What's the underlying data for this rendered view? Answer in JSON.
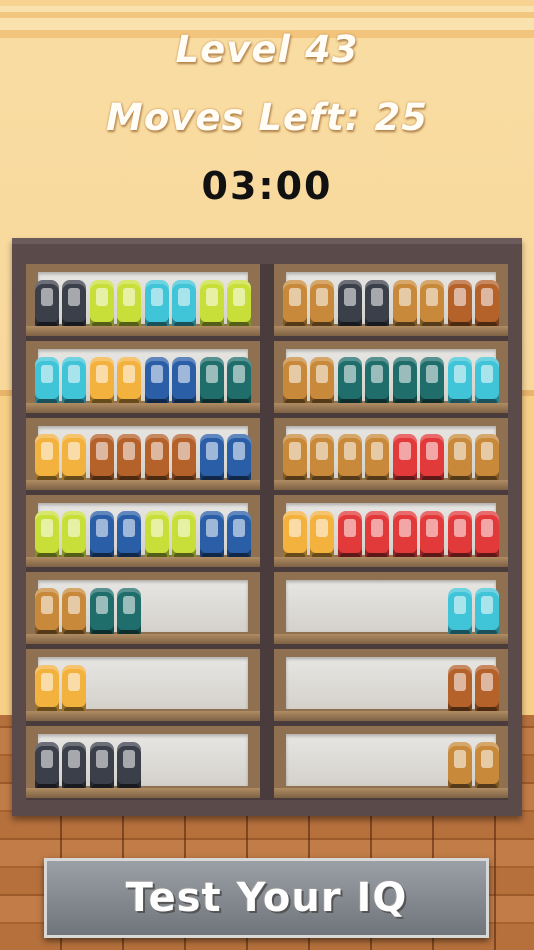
{
  "hud": {
    "level": "Level 43",
    "moves": "Moves Left: 25",
    "timer": "03:00"
  },
  "colors": {
    "sky": "#40c4d8",
    "navy": "#2a5fa8",
    "teal": "#1f6e6b",
    "lime": "#c8df3a",
    "purple": "#3b3f4a",
    "brown": "#b4612a",
    "tan": "#c88a3a",
    "red": "#e23a3a",
    "graffiti": "#f3b13e",
    "blackwhite": "#444444"
  },
  "shelves": [
    {
      "label": "shelf-1-left",
      "pairs": [
        "purple",
        "lime",
        "sky",
        "lime"
      ]
    },
    {
      "label": "shelf-1-right",
      "pairs": [
        "tan",
        "purple",
        "tan",
        "brown"
      ]
    },
    {
      "label": "shelf-2-left",
      "pairs": [
        "sky",
        "graffiti",
        "navy",
        "teal"
      ]
    },
    {
      "label": "shelf-2-right",
      "pairs": [
        "tan",
        "teal",
        "teal",
        "sky"
      ]
    },
    {
      "label": "shelf-3-left",
      "pairs": [
        "graffiti",
        "brown",
        "brown",
        "navy"
      ]
    },
    {
      "label": "shelf-3-right",
      "pairs": [
        "tan",
        "tan",
        "red",
        "tan"
      ]
    },
    {
      "label": "shelf-4-left",
      "pairs": [
        "lime",
        "navy",
        "lime",
        "navy"
      ]
    },
    {
      "label": "shelf-4-right",
      "pairs": [
        "graffiti",
        "red",
        "red",
        "red"
      ]
    },
    {
      "label": "shelf-5-left",
      "pairs": [
        "tan",
        "teal",
        "",
        ""
      ]
    },
    {
      "label": "shelf-5-right",
      "pairs": [
        "",
        "",
        "",
        "sky"
      ]
    },
    {
      "label": "shelf-6-left",
      "pairs": [
        "graffiti",
        "",
        "",
        ""
      ]
    },
    {
      "label": "shelf-6-right",
      "pairs": [
        "",
        "",
        "",
        "brown"
      ]
    },
    {
      "label": "shelf-7-left",
      "pairs": [
        "purple",
        "purple",
        "",
        ""
      ]
    },
    {
      "label": "shelf-7-right",
      "pairs": [
        "",
        "",
        "",
        "tan"
      ]
    }
  ],
  "cta": {
    "label": "Test Your IQ"
  }
}
